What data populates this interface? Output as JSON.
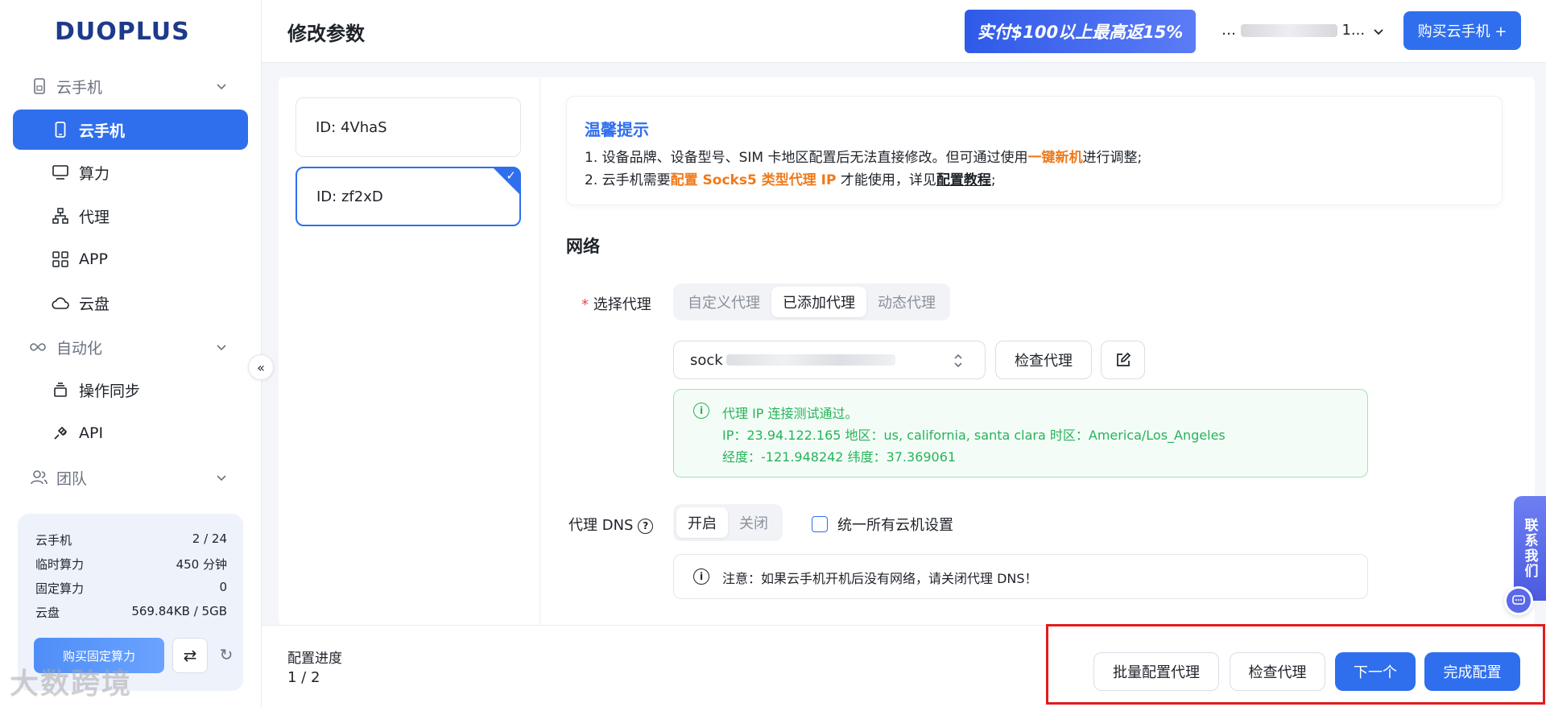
{
  "app": {
    "logo": "DUOPLUS",
    "watermark": "大数跨境"
  },
  "sidebar": {
    "groups": [
      {
        "label": "云手机",
        "icon": "phone-outline-icon"
      },
      {
        "label": "自动化",
        "icon": "infinity-icon"
      },
      {
        "label": "团队",
        "icon": "users-icon"
      }
    ],
    "items": [
      {
        "label": "云手机",
        "icon": "phone-icon",
        "active": true
      },
      {
        "label": "算力",
        "icon": "monitor-icon"
      },
      {
        "label": "代理",
        "icon": "network-icon"
      },
      {
        "label": "APP",
        "icon": "grid-icon"
      },
      {
        "label": "云盘",
        "icon": "cloud-icon"
      },
      {
        "label": "操作同步",
        "icon": "layers-icon"
      },
      {
        "label": "API",
        "icon": "plug-icon"
      }
    ],
    "stats": [
      {
        "label": "云手机",
        "value": "2 / 24"
      },
      {
        "label": "临时算力",
        "value": "450 分钟"
      },
      {
        "label": "固定算力",
        "value": "0"
      },
      {
        "label": "云盘",
        "value": "569.84KB / 5GB"
      }
    ],
    "buy_fixed_label": "购买固定算力"
  },
  "header": {
    "title": "修改参数",
    "promo": "实付$100以上最高返15%",
    "user_prefix": "…",
    "user_suffix": "1...",
    "buy_button": "购买云手机 +"
  },
  "devices": [
    {
      "label": "ID: 4VhaS",
      "selected": false
    },
    {
      "label": "ID: zf2xD",
      "selected": true
    }
  ],
  "tips": {
    "title": "温馨提示",
    "line1_pre": "1. 设备品牌、设备型号、SIM 卡地区配置后无法直接修改。但可通过使用",
    "line1_hl": "一键新机",
    "line1_post": "进行调整;",
    "line2_pre": "2. 云手机需要",
    "line2_hl": "配置 Socks5 类型代理 IP",
    "line2_mid": " 才能使用，详见",
    "line2_link": "配置教程",
    "line2_post": ";"
  },
  "network": {
    "section_title": "网络",
    "proxy_label": "选择代理",
    "proxy_tabs": [
      "自定义代理",
      "已添加代理",
      "动态代理"
    ],
    "proxy_tab_selected": "已添加代理",
    "proxy_select_value": "sock",
    "check_proxy": "检查代理",
    "result_line1": "代理 IP 连接测试通过。",
    "result_line2": "IP：23.94.122.165  地区：us, california, santa clara  时区：America/Los_Angeles",
    "result_line3": "经度：-121.948242  纬度：37.369061",
    "dns_label": "代理 DNS",
    "dns_options": [
      "开启",
      "关闭"
    ],
    "dns_selected": "开启",
    "unify_label": "统一所有云机设置",
    "dns_note": "注意：如果云手机开机后没有网络，请关闭代理 DNS！"
  },
  "footer": {
    "progress_label": "配置进度",
    "progress_value": "1 / 2",
    "batch_proxy": "批量配置代理",
    "check_proxy": "检查代理",
    "next": "下一个",
    "finish": "完成配置"
  },
  "contact": {
    "label": "联系我们"
  }
}
